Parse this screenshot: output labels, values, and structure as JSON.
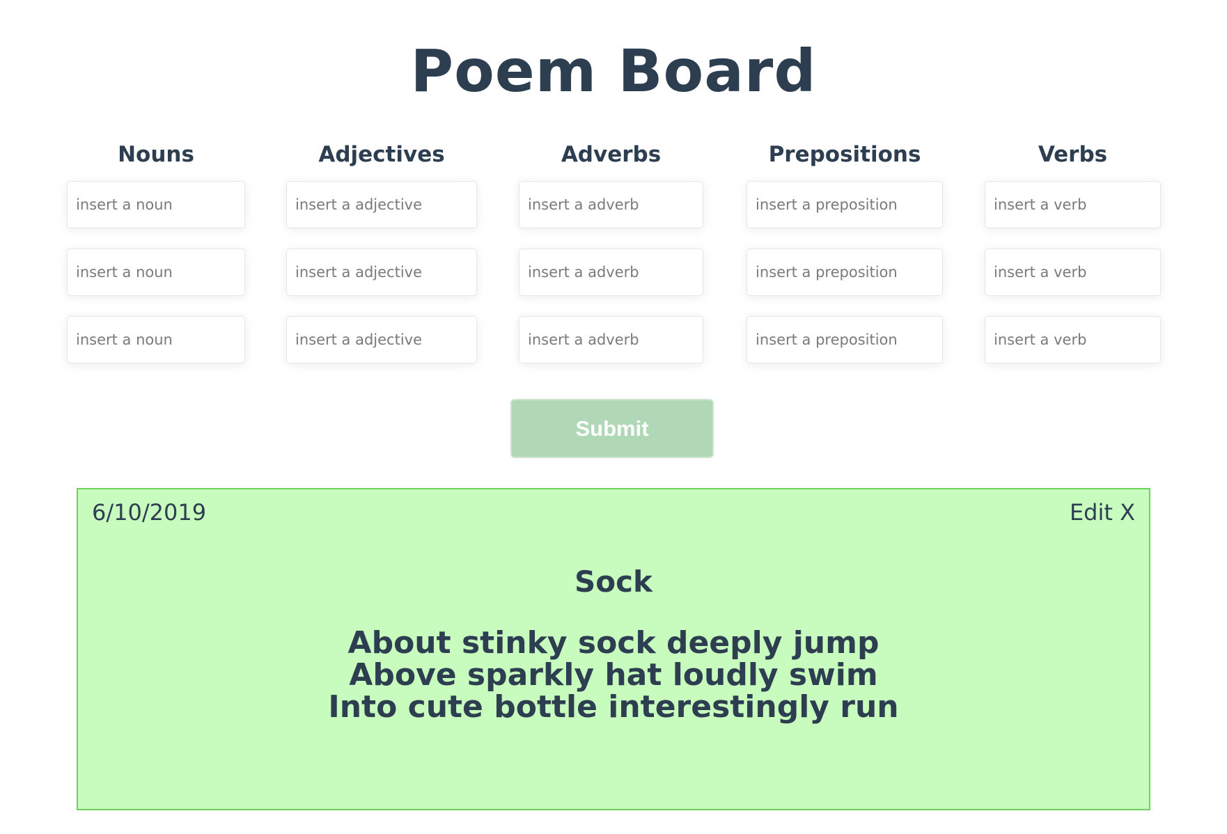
{
  "page": {
    "title": "Poem Board"
  },
  "columns": [
    {
      "heading": "Nouns",
      "placeholders": [
        "insert a noun",
        "insert a noun",
        "insert a noun"
      ]
    },
    {
      "heading": "Adjectives",
      "placeholders": [
        "insert a adjective",
        "insert a adjective",
        "insert a adjective"
      ]
    },
    {
      "heading": "Adverbs",
      "placeholders": [
        "insert a adverb",
        "insert a adverb",
        "insert a adverb"
      ]
    },
    {
      "heading": "Prepositions",
      "placeholders": [
        "insert a preposition",
        "insert a preposition",
        "insert a preposition"
      ]
    },
    {
      "heading": "Verbs",
      "placeholders": [
        "insert a verb",
        "insert a verb",
        "insert a verb"
      ]
    }
  ],
  "submit": {
    "label": "Submit"
  },
  "poem": {
    "date": "6/10/2019",
    "edit_label": "Edit",
    "delete_label": "X",
    "title": "Sock",
    "lines": [
      "About stinky sock deeply jump",
      "Above sparkly hat loudly swim",
      "Into cute bottle interestingly run"
    ]
  },
  "colors": {
    "text": "#2c3e50",
    "submit_bg": "#b1d8b6",
    "card_bg": "#c8fbbe",
    "card_border": "#6ed15e"
  }
}
